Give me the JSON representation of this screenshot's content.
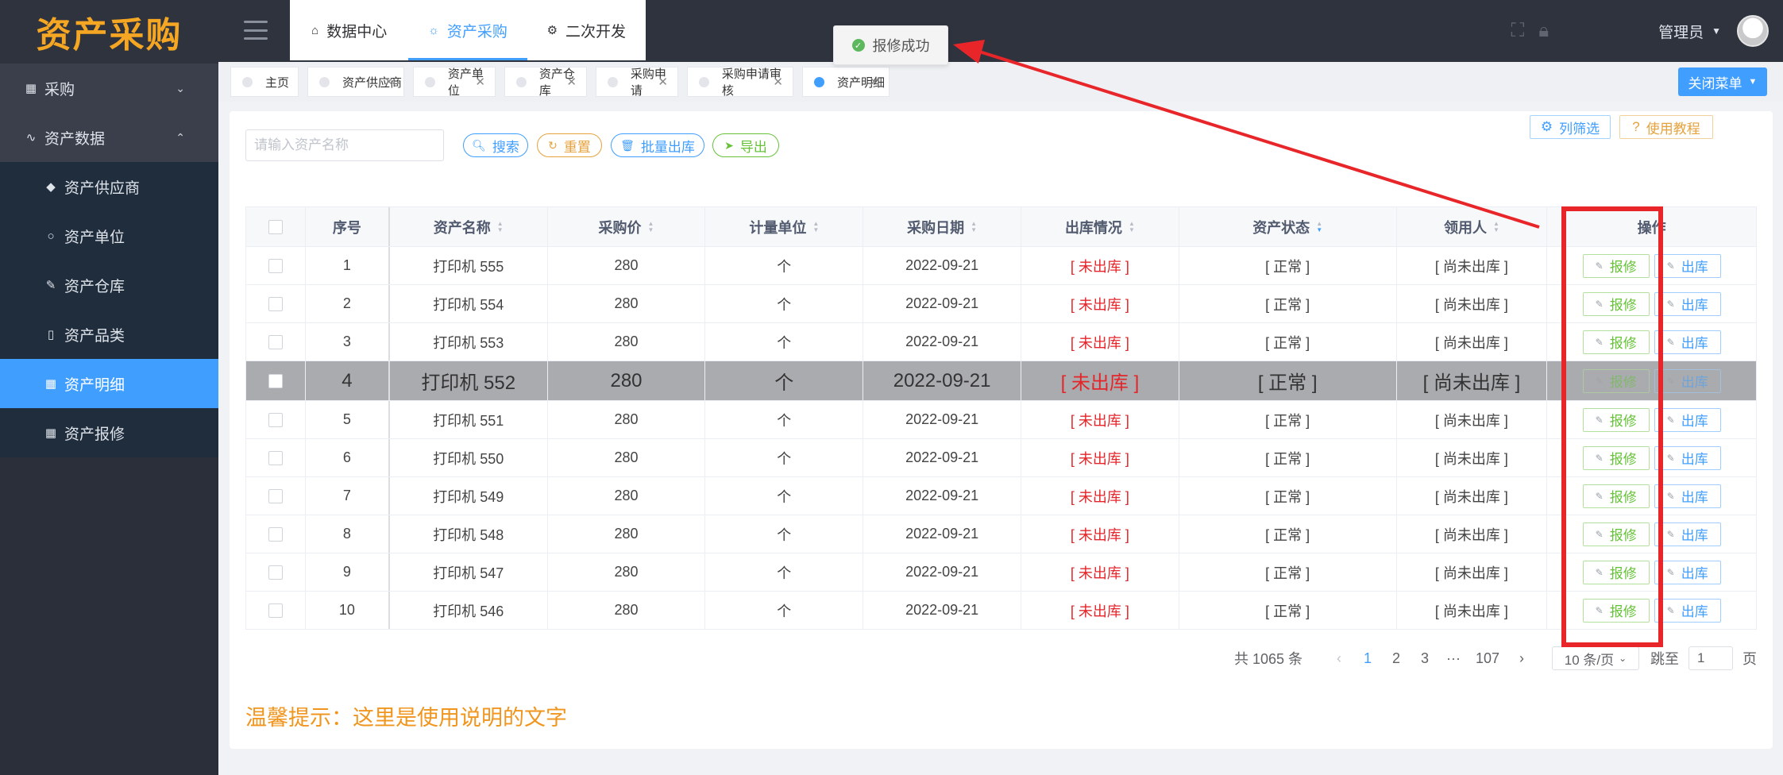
{
  "app": {
    "logo": "资产采购"
  },
  "sidebar": {
    "items": [
      {
        "icon": "▦",
        "label": "采购",
        "chevron": "⌄",
        "kind": "top"
      },
      {
        "icon": "∿",
        "label": "资产数据",
        "chevron": "⌃",
        "kind": "top-open"
      },
      {
        "icon": "◆",
        "label": "资产供应商",
        "kind": "sub"
      },
      {
        "icon": "○",
        "label": "资产单位",
        "kind": "sub"
      },
      {
        "icon": "✎",
        "label": "资产仓库",
        "kind": "sub"
      },
      {
        "icon": "▯",
        "label": "资产品类",
        "kind": "sub"
      },
      {
        "icon": "▦",
        "label": "资产明细",
        "kind": "sub",
        "active": true
      },
      {
        "icon": "▦",
        "label": "资产报修",
        "kind": "sub"
      }
    ]
  },
  "header": {
    "tabs": [
      {
        "icon": "⌂",
        "label": "数据中心"
      },
      {
        "icon": "☼",
        "label": "资产采购",
        "active": true
      },
      {
        "icon": "⚙",
        "label": "二次开发"
      }
    ],
    "user": "管理员"
  },
  "tags": [
    {
      "label": "主页",
      "closable": false
    },
    {
      "label": "资产供应商",
      "closable": true
    },
    {
      "label": "资产单位",
      "closable": true
    },
    {
      "label": "资产仓库",
      "closable": true
    },
    {
      "label": "采购申请",
      "closable": true
    },
    {
      "label": "采购申请审核",
      "closable": true
    },
    {
      "label": "资产明细",
      "closable": true,
      "active": true
    }
  ],
  "close_menu": "关闭菜单",
  "toast": {
    "message": "报修成功"
  },
  "toolbar": {
    "search_placeholder": "请输入资产名称",
    "search": "搜索",
    "reset": "重置",
    "batch_out": "批量出库",
    "export": "导出",
    "column_filter": "列筛选",
    "tutorial": "使用教程"
  },
  "table": {
    "columns": [
      "序号",
      "资产名称",
      "采购价",
      "计量单位",
      "采购日期",
      "出库情况",
      "资产状态",
      "领用人",
      "操作"
    ],
    "rows": [
      {
        "no": "1",
        "name": "打印机 555",
        "price": "280",
        "unit": "个",
        "date": "2022-09-21",
        "out": "[ 未出库 ]",
        "status": "[ 正常 ]",
        "user": "[ 尚未出库 ]"
      },
      {
        "no": "2",
        "name": "打印机 554",
        "price": "280",
        "unit": "个",
        "date": "2022-09-21",
        "out": "[ 未出库 ]",
        "status": "[ 正常 ]",
        "user": "[ 尚未出库 ]"
      },
      {
        "no": "3",
        "name": "打印机 553",
        "price": "280",
        "unit": "个",
        "date": "2022-09-21",
        "out": "[ 未出库 ]",
        "status": "[ 正常 ]",
        "user": "[ 尚未出库 ]"
      },
      {
        "no": "4",
        "name": "打印机 552",
        "price": "280",
        "unit": "个",
        "date": "2022-09-21",
        "out": "[ 未出库 ]",
        "status": "[ 正常 ]",
        "user": "[ 尚未出库 ]",
        "highlight": true
      },
      {
        "no": "5",
        "name": "打印机 551",
        "price": "280",
        "unit": "个",
        "date": "2022-09-21",
        "out": "[ 未出库 ]",
        "status": "[ 正常 ]",
        "user": "[ 尚未出库 ]"
      },
      {
        "no": "6",
        "name": "打印机 550",
        "price": "280",
        "unit": "个",
        "date": "2022-09-21",
        "out": "[ 未出库 ]",
        "status": "[ 正常 ]",
        "user": "[ 尚未出库 ]"
      },
      {
        "no": "7",
        "name": "打印机 549",
        "price": "280",
        "unit": "个",
        "date": "2022-09-21",
        "out": "[ 未出库 ]",
        "status": "[ 正常 ]",
        "user": "[ 尚未出库 ]"
      },
      {
        "no": "8",
        "name": "打印机 548",
        "price": "280",
        "unit": "个",
        "date": "2022-09-21",
        "out": "[ 未出库 ]",
        "status": "[ 正常 ]",
        "user": "[ 尚未出库 ]"
      },
      {
        "no": "9",
        "name": "打印机 547",
        "price": "280",
        "unit": "个",
        "date": "2022-09-21",
        "out": "[ 未出库 ]",
        "status": "[ 正常 ]",
        "user": "[ 尚未出库 ]"
      },
      {
        "no": "10",
        "name": "打印机 546",
        "price": "280",
        "unit": "个",
        "date": "2022-09-21",
        "out": "[ 未出库 ]",
        "status": "[ 正常 ]",
        "user": "[ 尚未出库 ]"
      }
    ],
    "actions": {
      "repair": "报修",
      "outbound": "出库"
    }
  },
  "pagination": {
    "total": "共 1065 条",
    "pages": [
      "1",
      "2",
      "3",
      "···",
      "107"
    ],
    "current": "1",
    "page_size": "10 条/页",
    "jump_label": "跳至",
    "jump_value": "1",
    "page_suffix": "页"
  },
  "tip": "温馨提示：这里是使用说明的文字",
  "colors": {
    "primary": "#409eff",
    "sidebar": "#2b2f3a",
    "danger": "#e3262a",
    "warning": "#f0951e",
    "annotation": "#e8262a"
  }
}
